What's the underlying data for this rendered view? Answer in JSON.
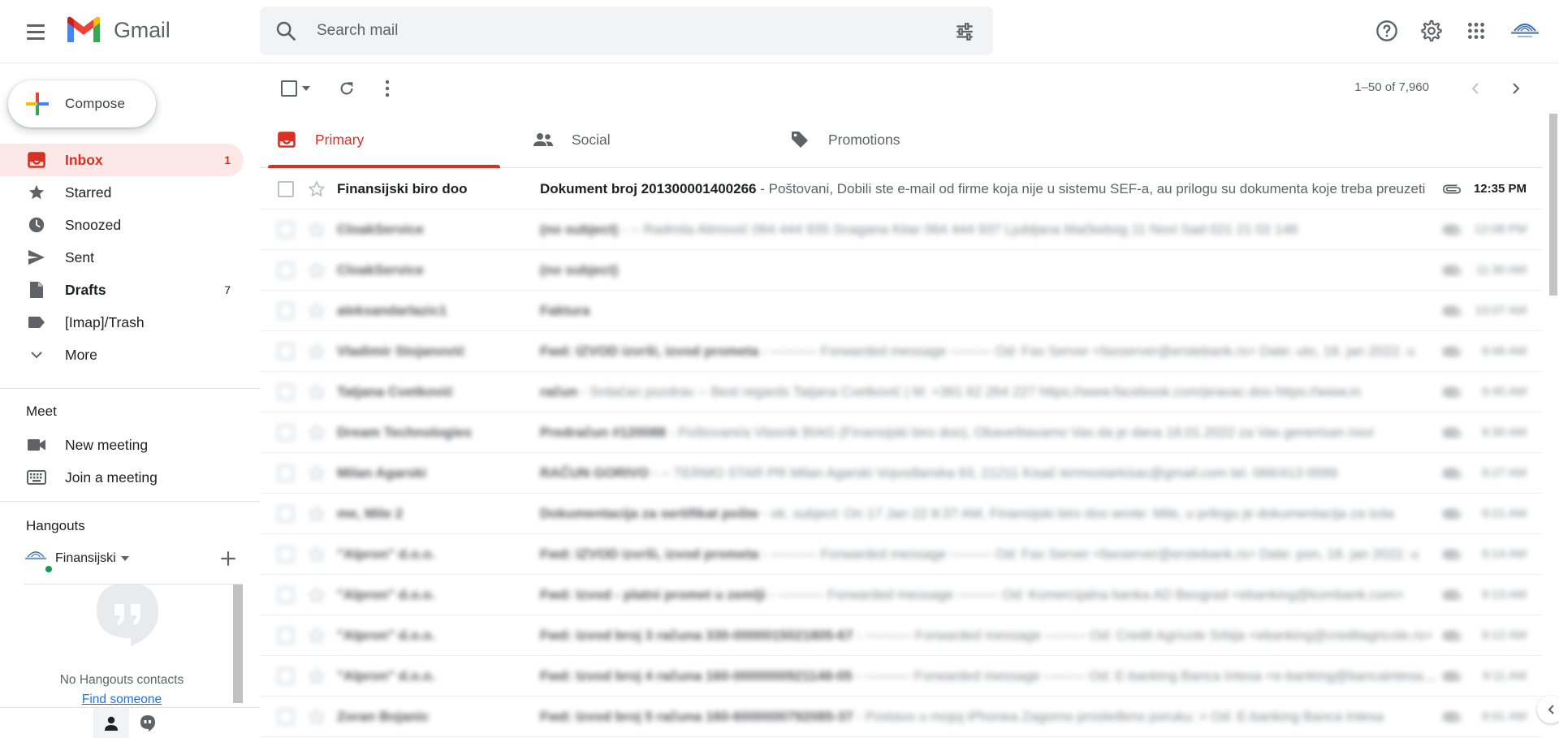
{
  "app": {
    "name": "Gmail"
  },
  "search": {
    "placeholder": "Search mail"
  },
  "compose": {
    "label": "Compose"
  },
  "nav": [
    {
      "label": "Inbox",
      "count": "1",
      "icon": "inbox-icon"
    },
    {
      "label": "Starred",
      "count": "",
      "icon": "star-icon"
    },
    {
      "label": "Snoozed",
      "count": "",
      "icon": "clock-icon"
    },
    {
      "label": "Sent",
      "count": "",
      "icon": "send-icon"
    },
    {
      "label": "Drafts",
      "count": "7",
      "icon": "draft-icon"
    },
    {
      "label": "[Imap]/Trash",
      "count": "",
      "icon": "label-icon"
    },
    {
      "label": "More",
      "count": "",
      "icon": "chevron-down-icon"
    }
  ],
  "meet": {
    "title": "Meet",
    "new_meeting": "New meeting",
    "join_meeting": "Join a meeting"
  },
  "hangouts": {
    "title": "Hangouts",
    "user": "Finansijski",
    "no_contacts": "No Hangouts contacts",
    "find_someone": "Find someone"
  },
  "pager": {
    "text": "1–50 of 7,960"
  },
  "tabs": [
    {
      "label": "Primary",
      "icon": "inbox-icon"
    },
    {
      "label": "Social",
      "icon": "people-icon"
    },
    {
      "label": "Promotions",
      "icon": "tag-icon"
    }
  ],
  "emails": [
    {
      "sender": "Finansijski biro doo",
      "subject": "Dokument broj 201300001400266",
      "snippet": " - Poštovani, Dobili ste e-mail od firme koja nije u sistemu SEF-a, au prilogu su dokumenta koje treba preuzeti",
      "time": "12:35 PM",
      "unread": true,
      "attachment": true
    },
    {
      "sender": "CloakService",
      "subject": "(no subject)",
      "snippet": " - -- Radmila Alimović 064 444 935 Snagana Kitar 064 444 937 Ljubljana Mačkebog 11 Novi Sad 021 21 02 146",
      "time": "12:08 PM",
      "unread": false,
      "attachment": true
    },
    {
      "sender": "CloakService",
      "subject": "(no subject)",
      "snippet": "",
      "time": "11:30 AM",
      "unread": false,
      "attachment": true
    },
    {
      "sender": "aleksandarlazic1",
      "subject": "Faktura",
      "snippet": "",
      "time": "10:07 AM",
      "unread": false,
      "attachment": true
    },
    {
      "sender": "Vladimir Stojanović",
      "subject": "Fwd: IZVOD izvrši, izvod prometa",
      "snippet": " - ---------- Forwarded message --------- Od: Fax Server <faxserver@erstebank.rs> Date: uto, 18. jan 2022. u",
      "time": "9:46 AM",
      "unread": false,
      "attachment": true
    },
    {
      "sender": "Tatjana Cvetković",
      "subject": "račun",
      "snippet": " - Srdačan pozdrav -- Best regards Tatjana Cvetković | M: +381 62 264 227 https://www.facebook.com/pravac.doo https://www.in",
      "time": "9:45 AM",
      "unread": false,
      "attachment": true
    },
    {
      "sender": "Dream Technologies",
      "subject": "Predračun #120088",
      "snippet": " - Poštovani/a Vlasnik BIAG (Finansijski biro doo), Obaveštavamo Vas da je dana 18.01.2022 za Vas generisan novi",
      "time": "9:30 AM",
      "unread": false,
      "attachment": true
    },
    {
      "sender": "Milan Agarski",
      "subject": "RAČUN GORIVO",
      "snippet": " - -- TERMO STAR PR Milan Agarski Vojvođanska 93, 21211 Kisač termostarkisac@gmail.com tel. 066/413 0099",
      "time": "9:27 AM",
      "unread": false,
      "attachment": true
    },
    {
      "sender": "me, Mile 2",
      "subject": "Dokumentacija za sertifikat pošte",
      "snippet": " - ok. subject: On 17 Jan 22 8:37 AM, Finansijski biro doo wrote: Mile, u prilogu je dokumentacija za izda",
      "time": "9:21 AM",
      "unread": false,
      "attachment": true
    },
    {
      "sender": "\"Alpron\" d.o.o.",
      "subject": "Fwd: IZVOD izvrši, izvod prometa",
      "snippet": " - ---------- Forwarded message --------- Od: Fax Server <faxserver@erstebank.rs> Date: pon, 18. jan 2022. u",
      "time": "9:14 AM",
      "unread": false,
      "attachment": true
    },
    {
      "sender": "\"Alpron\" d.o.o.",
      "subject": "Fwd: Izvod - platni promet u zemlji",
      "snippet": " - ---------- Forwarded message --------- Od: Komercijalna banka AD Beograd <ebanking@kombank.com>",
      "time": "9:13 AM",
      "unread": false,
      "attachment": true
    },
    {
      "sender": "\"Alpron\" d.o.o.",
      "subject": "Fwd: Izvod broj 3 računa 330-0000015021805-67",
      "snippet": " - ---------- Forwarded message --------- Od: Credit Agricole Srbija <ebanking@creditagricole.rs>",
      "time": "9:12 AM",
      "unread": false,
      "attachment": true
    },
    {
      "sender": "\"Alpron\" d.o.o.",
      "subject": "Fwd: Izvod broj 4 računa 160-0000000921148-05",
      "snippet": " - ---------- Forwarded message --------- Od: E-banking Banca Intesa <e-banking@bancaintesa.rs>",
      "time": "9:11 AM",
      "unread": false,
      "attachment": true
    },
    {
      "sender": "Zoran Bojanic",
      "subject": "Fwd: Izvod broj 5 računa 160-6000000792085-37",
      "snippet": " - Postavo u mojoj iPhonea Zagorno prosleđeno poruku: > Od: E-banking Banca Intesa",
      "time": "9:01 AM",
      "unread": false,
      "attachment": true
    }
  ],
  "colors": {
    "accent": "#d93025",
    "active_bg": "#fce8e6",
    "link": "#1a73e8"
  }
}
